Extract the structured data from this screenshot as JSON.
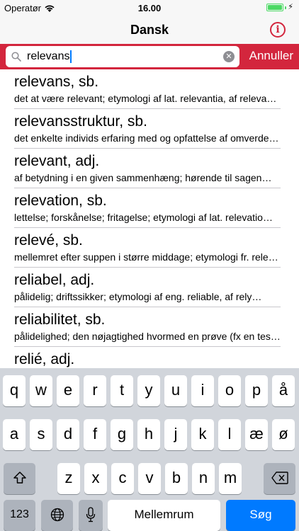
{
  "status": {
    "carrier": "Operatør",
    "time": "16.00",
    "battery_level": 1.0
  },
  "nav": {
    "title": "Dansk",
    "info_icon": "info-icon"
  },
  "search": {
    "value": "relevans",
    "cancel_label": "Annuller"
  },
  "results": [
    {
      "title": "relevans, sb.",
      "desc": "det at være relevant; etymologi af lat. relevantia, af relevant…"
    },
    {
      "title": "relevansstruktur, sb.",
      "desc": "det enkelte individs erfaring med og opfattelse af omverdenen…"
    },
    {
      "title": "relevant, adj.",
      "desc": "af betydning i en given sammenhæng; hørende til sagen…"
    },
    {
      "title": "relevation, sb.",
      "desc": "lettelse; forskånelse; fritagelse; etymologi af lat. relevatio…"
    },
    {
      "title": "relevé, sb.",
      "desc": "mellemret efter suppen i større middage; etymologi fr. relevé…"
    },
    {
      "title": "reliabel, adj.",
      "desc": "pålidelig; driftssikker; etymologi af eng. reliable, af rely…"
    },
    {
      "title": "reliabilitet, sb.",
      "desc": "pålidelighed; den nøjagtighed hvormed en prøve (fx en test)…"
    },
    {
      "title": "relié, adj.",
      "desc": ""
    }
  ],
  "keyboard": {
    "row1": [
      "q",
      "w",
      "e",
      "r",
      "t",
      "y",
      "u",
      "i",
      "o",
      "p",
      "å"
    ],
    "row2": [
      "a",
      "s",
      "d",
      "f",
      "g",
      "h",
      "j",
      "k",
      "l",
      "æ",
      "ø"
    ],
    "row3": [
      "z",
      "x",
      "c",
      "v",
      "b",
      "n",
      "m"
    ],
    "numbers_label": "123",
    "space_label": "Mellemrum",
    "search_label": "Søg",
    "shift_icon": "shift-icon",
    "backspace_icon": "backspace-icon",
    "globe_icon": "globe-icon",
    "mic_icon": "microphone-icon"
  }
}
